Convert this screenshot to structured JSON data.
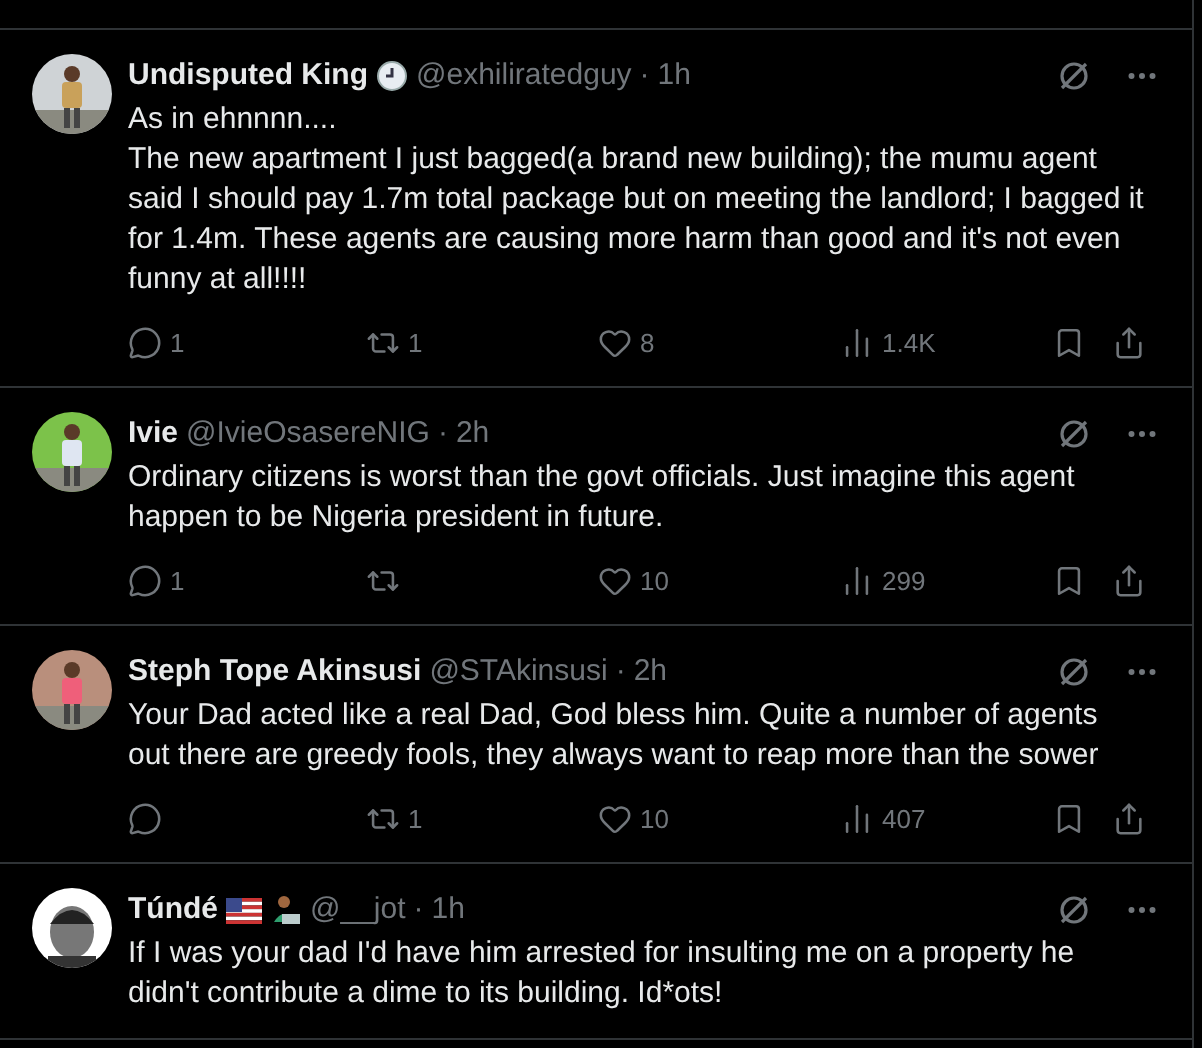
{
  "tweets": [
    {
      "name": "Undisputed King",
      "badges": [
        {
          "kind": "clock"
        }
      ],
      "handle": "@exhiliratedguy",
      "separator": "·",
      "time": "1h",
      "text": [
        "As in ehnnnn....",
        "The new apartment I just bagged(a brand new building); the mumu agent said I should pay 1.7m total package but on meeting the landlord; I bagged it for 1.4m. These agents are causing more harm than good and it's not even funny at all!!!!"
      ],
      "avatar": {
        "kind": "picture"
      },
      "replies": "1",
      "reposts": "1",
      "likes": "8",
      "views": "1.4K"
    },
    {
      "name": "Ivie",
      "handle": "@IvieOsasereNIG",
      "separator": "·",
      "time": "2h",
      "text": [
        "Ordinary citizens is worst than the govt officials. Just imagine this agent happen to be Nigeria president in future."
      ],
      "avatar": {
        "kind": "picture"
      },
      "replies": "1",
      "likes": "10",
      "views": "299"
    },
    {
      "name": "Steph Tope Akinsusi",
      "handle": "@STAkinsusi",
      "separator": "·",
      "time": "2h",
      "text": [
        "Your Dad acted like a real Dad, God bless him. Quite a number of agents out there are greedy fools, they always want to reap more than the sower"
      ],
      "avatar": {
        "kind": "picture"
      },
      "reposts": "1",
      "likes": "10",
      "views": "407"
    },
    {
      "name": "Túndé",
      "badges": [
        {
          "kind": "flag"
        },
        {
          "kind": "laptop"
        }
      ],
      "handle": "@__jot",
      "separator": "·",
      "time": "1h",
      "text": [
        "If I was your dad I'd have him arrested for insulting me on a property he didn't contribute a dime to its building. Id*ots!"
      ],
      "avatar": {
        "kind": "cartoon"
      }
    }
  ]
}
